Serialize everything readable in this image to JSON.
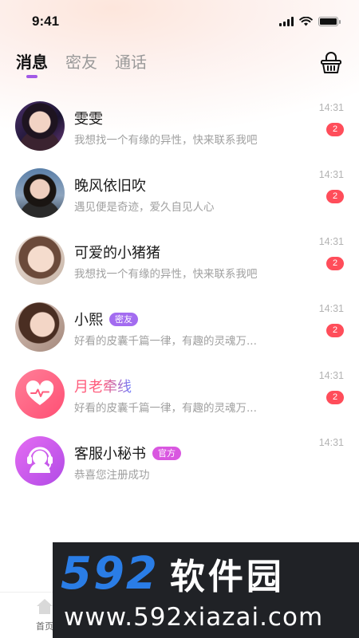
{
  "status_bar": {
    "time": "9:41"
  },
  "tabs": [
    {
      "label": "消息",
      "active": true
    },
    {
      "label": "密友",
      "active": false
    },
    {
      "label": "通话",
      "active": false
    }
  ],
  "header": {
    "right_icon": "basket-icon"
  },
  "conversations": [
    {
      "name": "雯雯",
      "message": "我想找一个有缘的异性，快来联系我吧",
      "time": "14:31",
      "badge": "2",
      "tag": "",
      "avatar": "photo"
    },
    {
      "name": "晚风依旧吹",
      "message": "遇见便是奇迹，爱久自见人心",
      "time": "14:31",
      "badge": "2",
      "tag": "",
      "avatar": "photo"
    },
    {
      "name": "可爱的小猪猪",
      "message": "我想找一个有缘的异性，快来联系我吧",
      "time": "14:31",
      "badge": "2",
      "tag": "",
      "avatar": "photo"
    },
    {
      "name": "小熙",
      "message": "好看的皮囊千篇一律，有趣的灵魂万...",
      "time": "14:31",
      "badge": "2",
      "tag": "密友",
      "avatar": "photo"
    },
    {
      "name": "月老牵线",
      "message": "好看的皮囊千篇一律，有趣的灵魂万...",
      "time": "14:31",
      "badge": "2",
      "tag": "",
      "avatar": "heart-icon"
    },
    {
      "name": "客服小秘书",
      "message": "恭喜您注册成功",
      "time": "14:31",
      "badge": "",
      "tag": "官方",
      "avatar": "headset-icon"
    }
  ],
  "bottom_nav": {
    "home_label": "首页"
  },
  "watermark": {
    "number": "592",
    "brand": "软件园",
    "url": "www.592xiazai.com"
  },
  "colors": {
    "accent": "#a259e6",
    "badge": "#ff4d5a",
    "friend_tag": "#a36cf0",
    "official_tag": "#d957e0"
  }
}
